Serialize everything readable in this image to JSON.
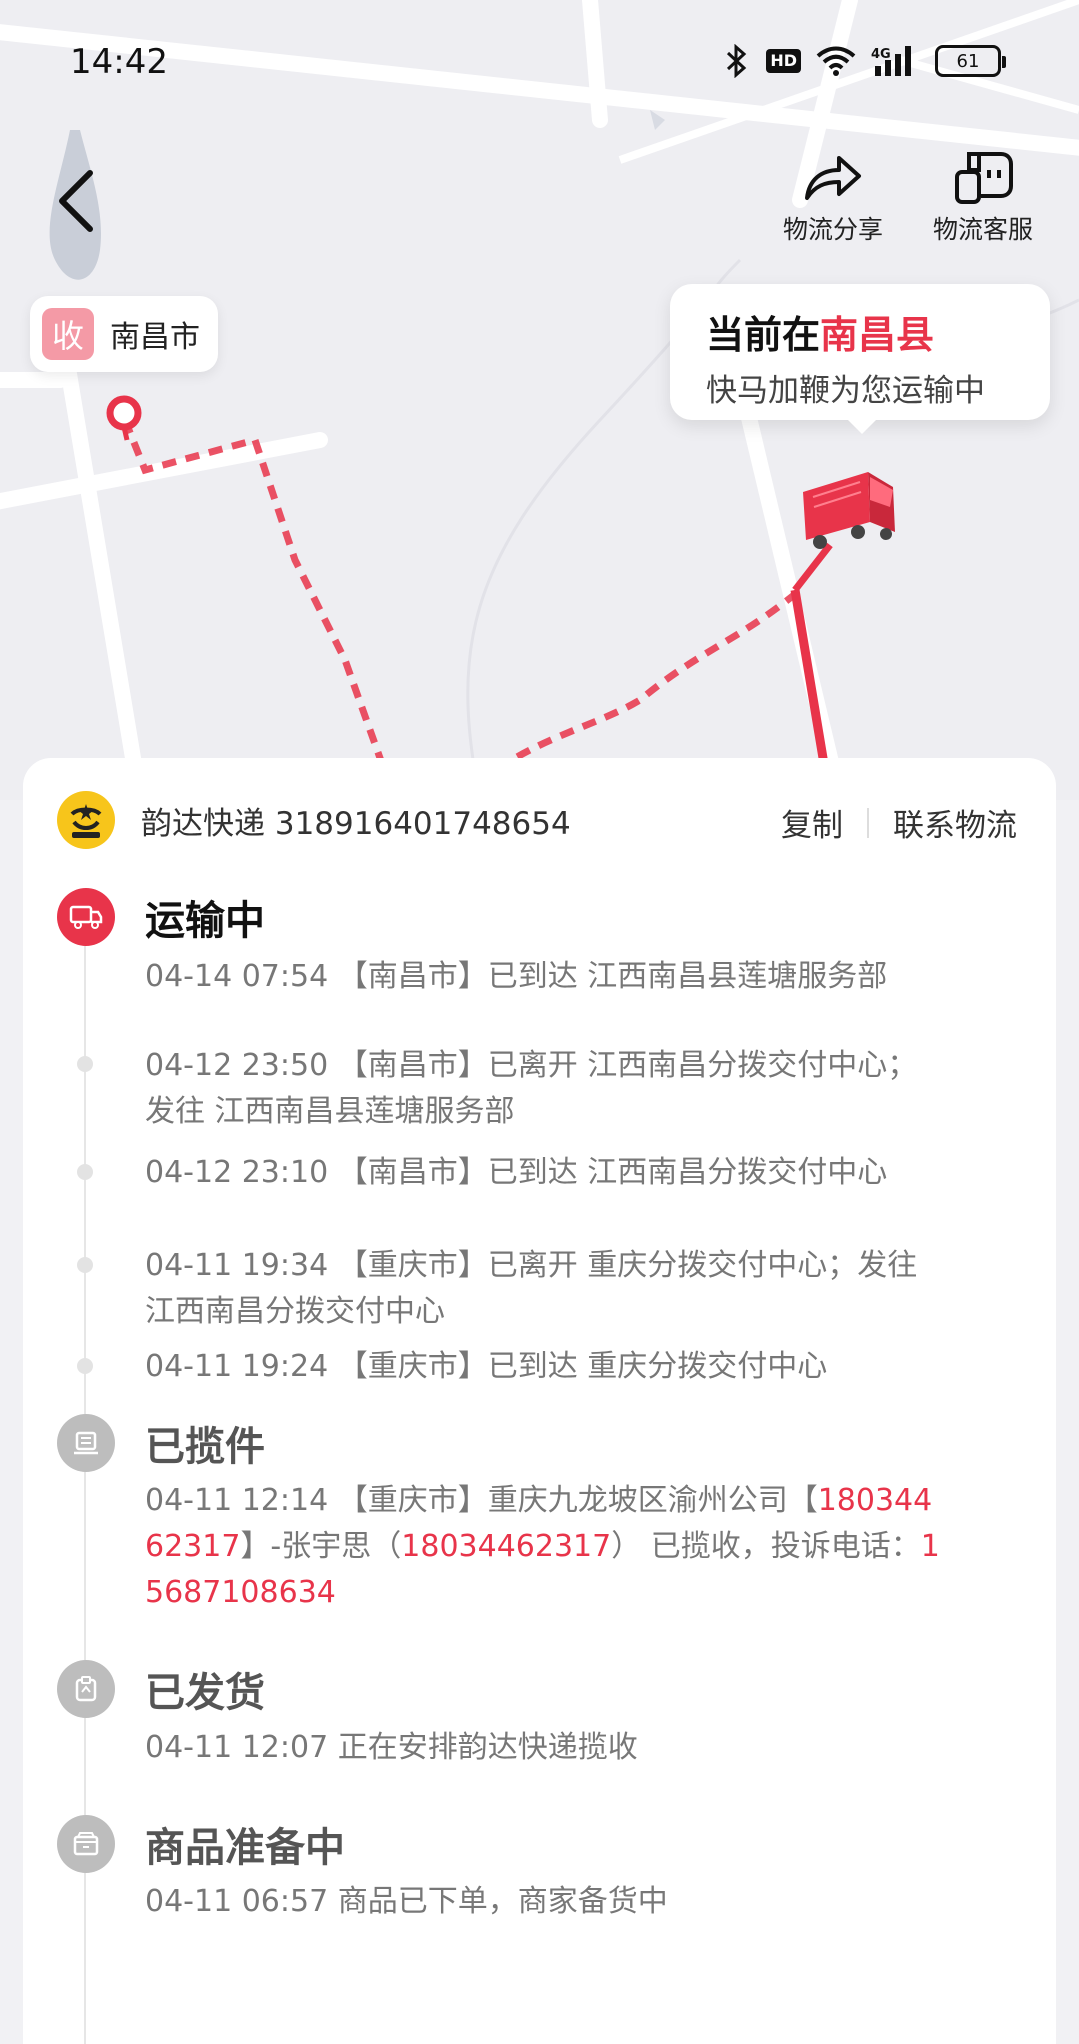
{
  "status_bar": {
    "time": "14:42",
    "hd": "HD",
    "network": "4G",
    "battery": "61"
  },
  "header": {
    "share_label": "物流分享",
    "service_label": "物流客服"
  },
  "map": {
    "receiver_badge": "收",
    "receiver_city": "南昌市",
    "bubble_prefix": "当前在",
    "bubble_location": "南昌县",
    "bubble_subtitle": "快马加鞭为您运输中"
  },
  "courier": {
    "name_and_number": "韵达快递 318916401748654",
    "copy_label": "复制",
    "contact_label": "联系物流"
  },
  "timeline": {
    "transit": {
      "title": "运输中",
      "entries": [
        {
          "text": "04-14 07:54 【南昌市】已到达 江西南昌县莲塘服务部"
        },
        {
          "line1": "04-12 23:50 【南昌市】已离开 江西南昌分拨交付中心；",
          "line2": "发往 江西南昌县莲塘服务部"
        },
        {
          "text": "04-12 23:10 【南昌市】已到达 江西南昌分拨交付中心"
        },
        {
          "line1": "04-11 19:34 【重庆市】已离开 重庆分拨交付中心；发往",
          "line2": "江西南昌分拨交付中心"
        },
        {
          "text": "04-11 19:24 【重庆市】已到达 重庆分拨交付中心"
        }
      ]
    },
    "picked_up": {
      "title": "已揽件",
      "p1": "04-11 12:14 【重庆市】重庆九龙坡区渝州公司【",
      "phone_a1": "180344",
      "phone_a2": "62317",
      "p2": "】-张宇思（",
      "phone_b": "18034462317",
      "p3": "） 已揽收，投诉电话：",
      "phone_c1": "1",
      "phone_c2": "5687108634"
    },
    "shipped": {
      "title": "已发货",
      "text": "04-11 12:07 正在安排韵达快递揽收"
    },
    "preparing": {
      "title": "商品准备中",
      "text": "04-11 06:57 商品已下单，商家备货中"
    }
  },
  "colors": {
    "accent": "#e8344a",
    "courier_yellow": "#f7c51b"
  }
}
